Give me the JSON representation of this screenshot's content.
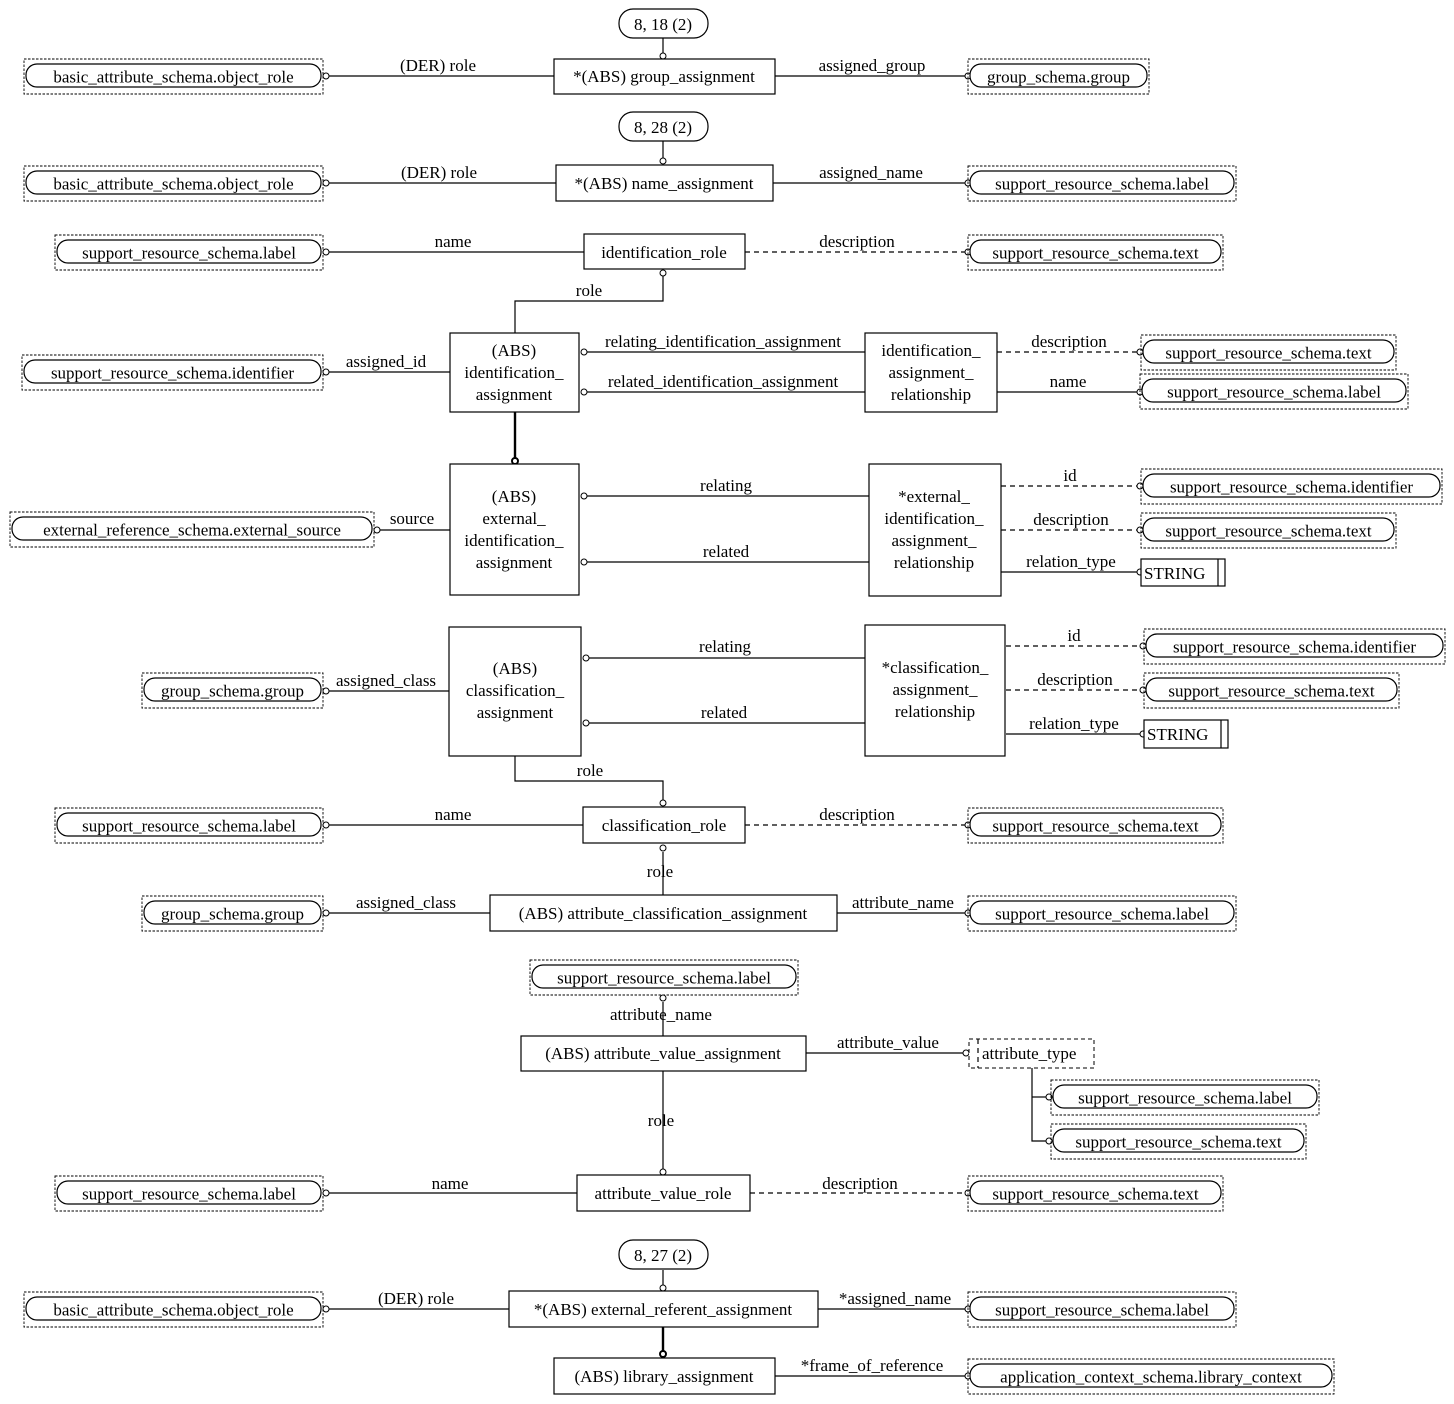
{
  "diagram": {
    "type": "EXPRESS-G schema diagram",
    "page_refs": {
      "ref1": "8, 18 (2)",
      "ref2": "8, 28 (2)",
      "ref3": "8, 27 (2)"
    },
    "entities": {
      "group_assignment": "*(ABS) group_assignment",
      "name_assignment": "*(ABS) name_assignment",
      "identification_role": "identification_role",
      "identification_assignment": [
        "(ABS)",
        "identification_",
        "assignment"
      ],
      "identification_assignment_relationship": [
        "identification_",
        "assignment_",
        "relationship"
      ],
      "external_identification_assignment": [
        "(ABS)",
        "external_",
        "identification_",
        "assignment"
      ],
      "external_identification_assignment_relationship": [
        "*external_",
        "identification_",
        "assignment_",
        "relationship"
      ],
      "classification_assignment": [
        "(ABS)",
        "classification_",
        "assignment"
      ],
      "classification_assignment_relationship": [
        "*classification_",
        "assignment_",
        "relationship"
      ],
      "classification_role": "classification_role",
      "attribute_classification_assignment": "(ABS) attribute_classification_assignment",
      "attribute_value_assignment": "(ABS) attribute_value_assignment",
      "attribute_value_role": "attribute_value_role",
      "external_referent_assignment": "*(ABS) external_referent_assignment",
      "library_assignment": "(ABS) library_assignment"
    },
    "references": {
      "r_object_role_1": "basic_attribute_schema.object_role",
      "r_group_1": "group_schema.group",
      "r_object_role_2": "basic_attribute_schema.object_role",
      "r_label_1": "support_resource_schema.label",
      "r_label_2": "support_resource_schema.label",
      "r_text_1": "support_resource_schema.text",
      "r_identifier_1": "support_resource_schema.identifier",
      "r_text_2": "support_resource_schema.text",
      "r_label_3": "support_resource_schema.label",
      "r_external_source": "external_reference_schema.external_source",
      "r_identifier_2": "support_resource_schema.identifier",
      "r_text_3": "support_resource_schema.text",
      "r_group_2": "group_schema.group",
      "r_identifier_3": "support_resource_schema.identifier",
      "r_text_4": "support_resource_schema.text",
      "r_label_4": "support_resource_schema.label",
      "r_text_5": "support_resource_schema.text",
      "r_group_3": "group_schema.group",
      "r_label_5": "support_resource_schema.label",
      "r_label_6": "support_resource_schema.label",
      "r_label_7": "support_resource_schema.label",
      "r_text_6": "support_resource_schema.text",
      "r_label_8": "support_resource_schema.label",
      "r_text_7": "support_resource_schema.text",
      "r_object_role_3": "basic_attribute_schema.object_role",
      "r_label_9": "support_resource_schema.label",
      "r_library_context": "application_context_schema.library_context"
    },
    "select_types": {
      "attribute_type": "attribute_type"
    },
    "simple_types": {
      "string_1": "STRING",
      "string_2": "STRING"
    },
    "attributes": {
      "a1": "(DER) role",
      "a2": "assigned_group",
      "a3": "(DER) role",
      "a4": "assigned_name",
      "a5": "name",
      "a6": "description",
      "a7": "role",
      "a8": "assigned_id",
      "a9": "relating_identification_assignment",
      "a10": "related_identification_assignment",
      "a11": "description",
      "a12": "name",
      "a13": "source",
      "a14": "relating",
      "a15": "related",
      "a16": "id",
      "a17": "description",
      "a18": "relation_type",
      "a19": "assigned_class",
      "a20": "relating",
      "a21": "related",
      "a22": "id",
      "a23": "description",
      "a24": "relation_type",
      "a25": "role",
      "a26": "name",
      "a27": "description",
      "a28": "role",
      "a29": "assigned_class",
      "a30": "attribute_name",
      "a31": "attribute_name",
      "a32": "attribute_value",
      "a33": "role",
      "a34": "name",
      "a35": "description",
      "a36": "(DER) role",
      "a37": "*assigned_name",
      "a38": "*frame_of_reference"
    }
  }
}
